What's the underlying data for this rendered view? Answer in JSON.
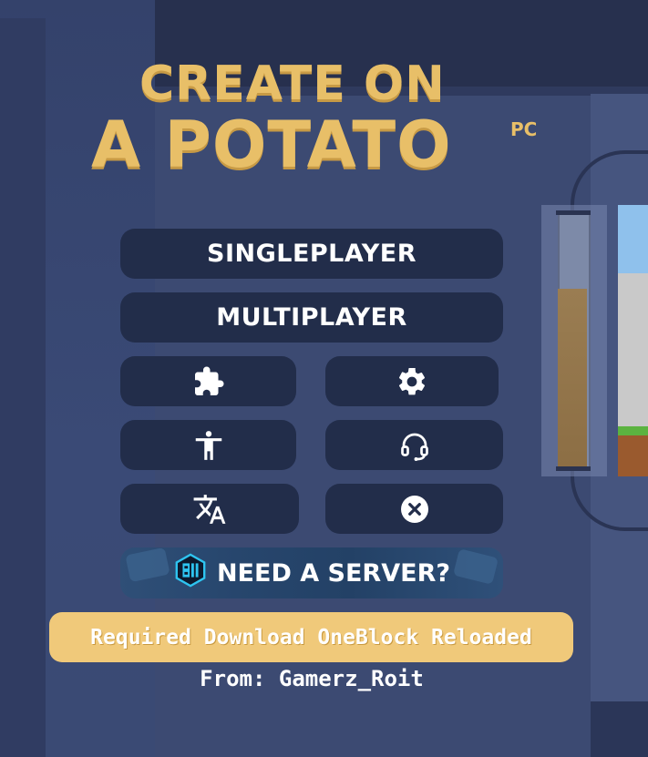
{
  "logo": {
    "line1": "CREATE ON",
    "line2": "A POTATO",
    "suffix": "PC"
  },
  "menu": {
    "singleplayer_label": "SINGLEPLAYER",
    "multiplayer_label": "MULTIPLAYER",
    "icon_buttons": [
      {
        "icon": "puzzle-icon"
      },
      {
        "icon": "gear-icon"
      },
      {
        "icon": "accessibility-icon"
      },
      {
        "icon": "headset-icon"
      },
      {
        "icon": "translate-icon"
      },
      {
        "icon": "close-circle-icon"
      }
    ],
    "server_label": "NEED A SERVER?"
  },
  "notice": {
    "text": "Required Download OneBlock Reloaded",
    "credit": "From: Gamerz_Roit"
  },
  "colors": {
    "logo_gold": "#e8bf68",
    "button_bg": "#222d4a",
    "notice_bg": "#f0c97a",
    "server_bg": "#27466d",
    "text": "#ffffff"
  }
}
